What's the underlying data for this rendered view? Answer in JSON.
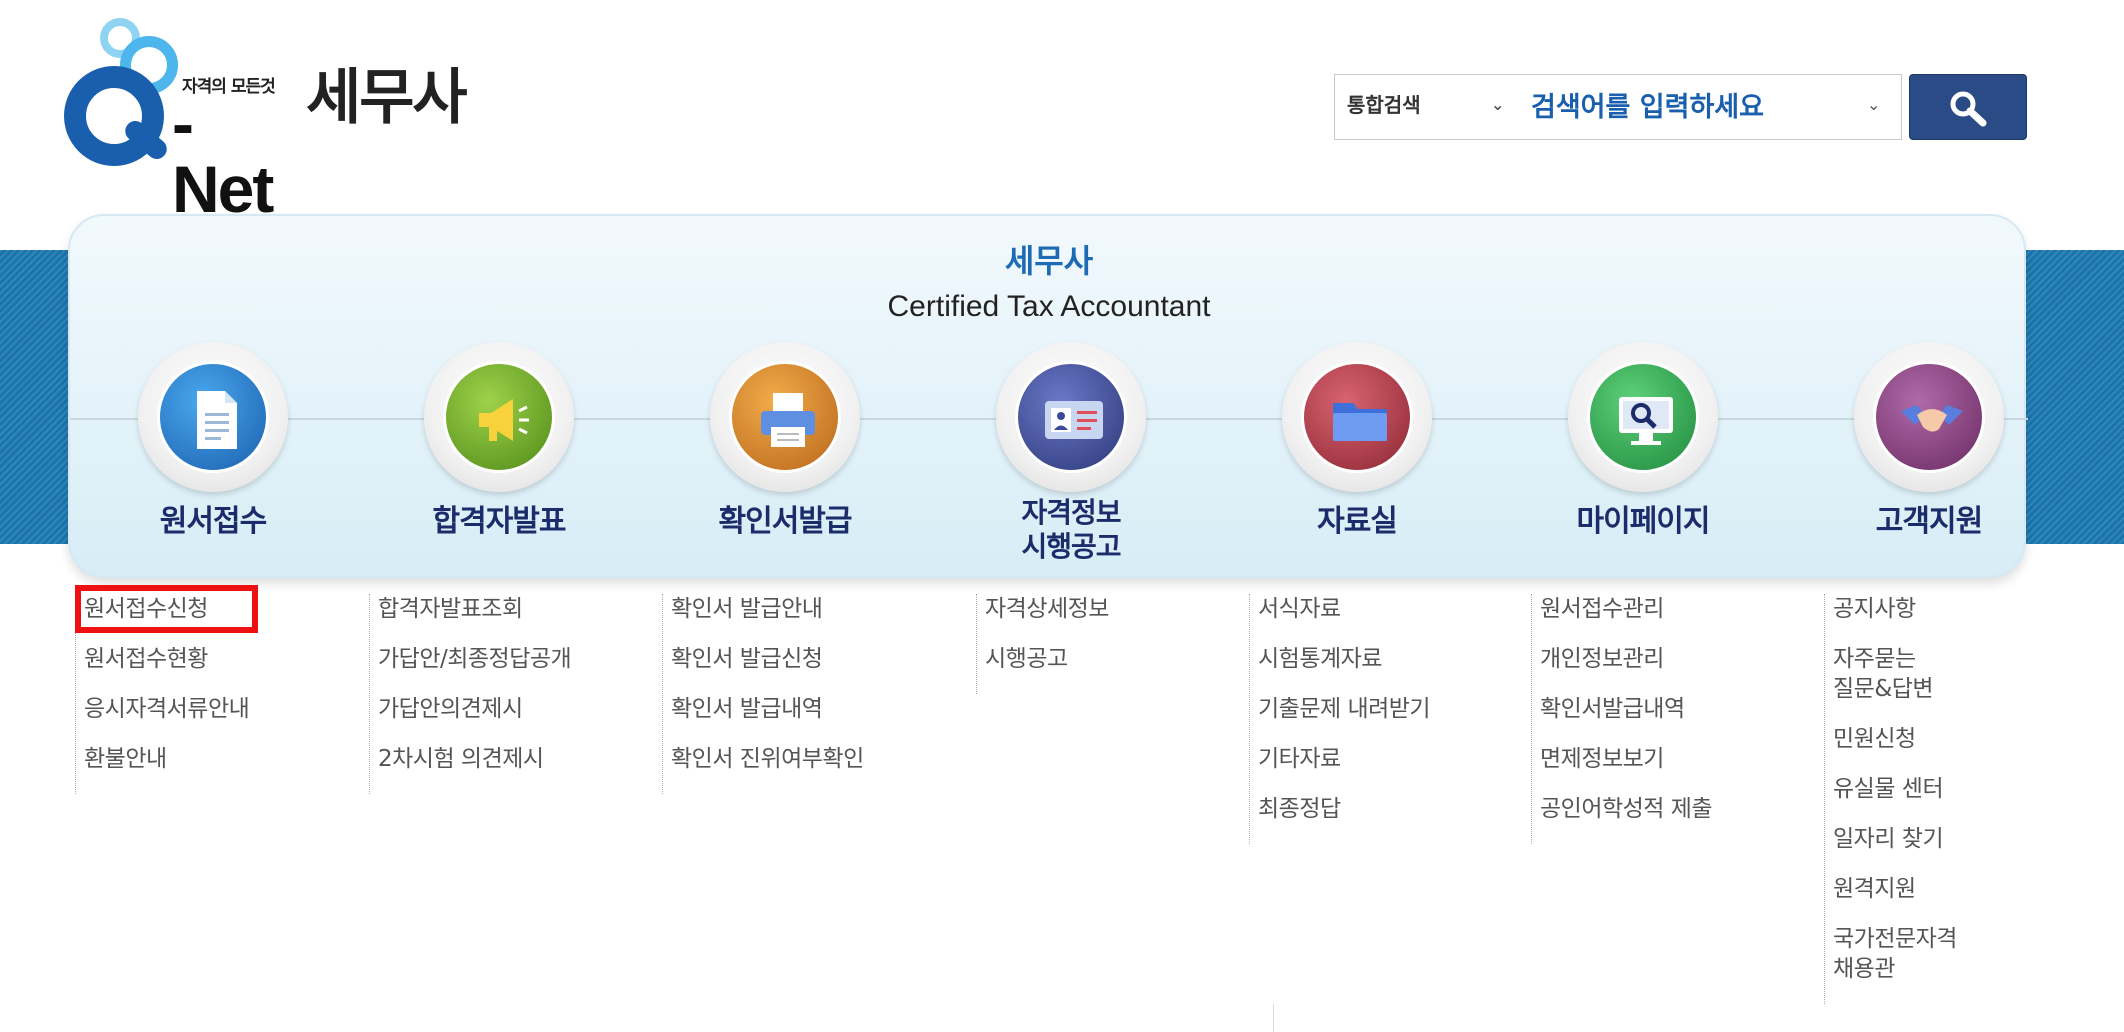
{
  "header": {
    "logo_tagline": "자격의 모든것",
    "logo_brand": "Q-Net",
    "page_title": "세무사",
    "search": {
      "category_selected": "통합검색",
      "placeholder": "검색어를 입력하세요"
    }
  },
  "panel": {
    "title": "세무사",
    "subtitle": "Certified Tax Accountant"
  },
  "menu": [
    {
      "label": "원서접수",
      "icon": "document-icon",
      "color": "#1f78c8"
    },
    {
      "label": "합격자발표",
      "icon": "megaphone-icon",
      "color": "#6aa321"
    },
    {
      "label": "확인서발급",
      "icon": "printer-icon",
      "color": "#e08a22"
    },
    {
      "label_line1": "자격정보",
      "label_line2": "시행공고",
      "icon": "id-card-icon",
      "color": "#3c4a9a"
    },
    {
      "label": "자료실",
      "icon": "folder-icon",
      "color": "#b83a44"
    },
    {
      "label": "마이페이지",
      "icon": "monitor-search-icon",
      "color": "#2eaa55"
    },
    {
      "label": "고객지원",
      "icon": "handshake-icon",
      "color": "#8a3d82"
    }
  ],
  "submenus": [
    [
      "원서접수신청",
      "원서접수현황",
      "응시자격서류안내",
      "환불안내"
    ],
    [
      "합격자발표조회",
      "가답안/최종정답공개",
      "가답안의견제시",
      "2차시험 의견제시"
    ],
    [
      "확인서 발급안내",
      "확인서 발급신청",
      "확인서 발급내역",
      "확인서 진위여부확인"
    ],
    [
      "자격상세정보",
      "시행공고"
    ],
    [
      "서식자료",
      "시험통계자료",
      "기출문제 내려받기",
      "기타자료",
      "최종정답"
    ],
    [
      "원서접수관리",
      "개인정보관리",
      "확인서발급내역",
      "면제정보보기",
      "공인어학성적 제출"
    ],
    [
      "공지사항",
      "자주묻는\n질문&답변",
      "민원신청",
      "유실물 센터",
      "일자리 찾기",
      "원격지원",
      "국가전문자격\n채용관"
    ]
  ],
  "highlighted_item": "원서접수신청"
}
